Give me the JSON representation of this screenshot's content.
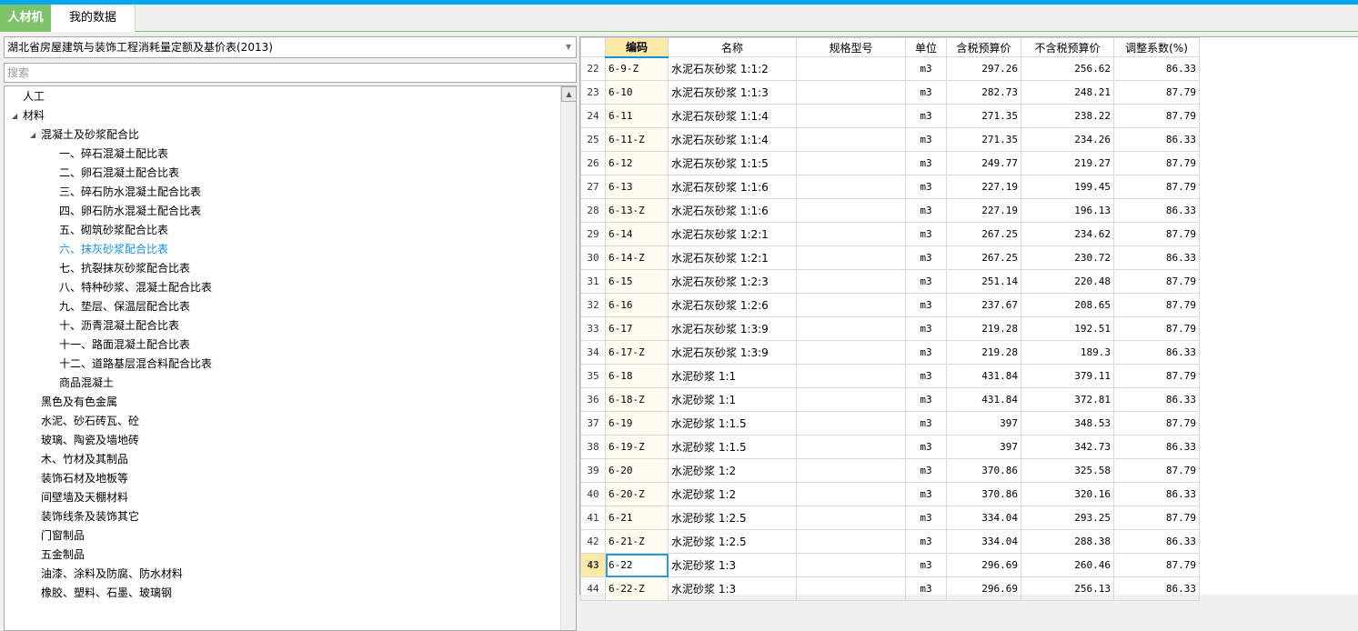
{
  "tabs": [
    {
      "label": "人材机"
    },
    {
      "label": "我的数据"
    }
  ],
  "library_select": {
    "value": "湖北省房屋建筑与装饰工程消耗量定额及基价表(2013)"
  },
  "search": {
    "placeholder": "搜索"
  },
  "tree": [
    {
      "label": "人工",
      "level": 0,
      "expand": false
    },
    {
      "label": "材料",
      "level": 0,
      "expand": true
    },
    {
      "label": "混凝土及砂浆配合比",
      "level": 1,
      "expand": true
    },
    {
      "label": "一、碎石混凝土配比表",
      "level": 2
    },
    {
      "label": "二、卵石混凝土配合比表",
      "level": 2
    },
    {
      "label": "三、碎石防水混凝土配合比表",
      "level": 2
    },
    {
      "label": "四、卵石防水混凝土配合比表",
      "level": 2
    },
    {
      "label": "五、砌筑砂浆配合比表",
      "level": 2
    },
    {
      "label": "六、抹灰砂浆配合比表",
      "level": 2,
      "selected": true
    },
    {
      "label": "七、抗裂抹灰砂浆配合比表",
      "level": 2
    },
    {
      "label": "八、特种砂浆、混凝土配合比表",
      "level": 2
    },
    {
      "label": "九、垫层、保温层配合比表",
      "level": 2
    },
    {
      "label": "十、沥青混凝土配合比表",
      "level": 2
    },
    {
      "label": "十一、路面混凝土配合比表",
      "level": 2
    },
    {
      "label": "十二、道路基层混合料配合比表",
      "level": 2
    },
    {
      "label": "商品混凝土",
      "level": 2
    },
    {
      "label": "黑色及有色金属",
      "level": 1
    },
    {
      "label": "水泥、砂石砖瓦、砼",
      "level": 1
    },
    {
      "label": "玻璃、陶瓷及墙地砖",
      "level": 1
    },
    {
      "label": "木、竹材及其制品",
      "level": 1
    },
    {
      "label": "装饰石材及地板等",
      "level": 1
    },
    {
      "label": "间壁墙及天棚材料",
      "level": 1
    },
    {
      "label": "装饰线条及装饰其它",
      "level": 1
    },
    {
      "label": "门窗制品",
      "level": 1
    },
    {
      "label": "五金制品",
      "level": 1
    },
    {
      "label": "油漆、涂料及防腐、防水材料",
      "level": 1
    },
    {
      "label": "橡胶、塑料、石墨、玻璃钢",
      "level": 1
    }
  ],
  "table": {
    "headers": [
      "",
      "编码",
      "名称",
      "规格型号",
      "单位",
      "含税预算价",
      "不含税预算价",
      "调整系数(%)"
    ],
    "current_row": "43",
    "rows": [
      [
        "22",
        "6-9-Z",
        "水泥石灰砂浆 1:1:2",
        "",
        "m3",
        "297.26",
        "256.62",
        "86.33"
      ],
      [
        "23",
        "6-10",
        "水泥石灰砂浆 1:1:3",
        "",
        "m3",
        "282.73",
        "248.21",
        "87.79"
      ],
      [
        "24",
        "6-11",
        "水泥石灰砂浆 1:1:4",
        "",
        "m3",
        "271.35",
        "238.22",
        "87.79"
      ],
      [
        "25",
        "6-11-Z",
        "水泥石灰砂浆 1:1:4",
        "",
        "m3",
        "271.35",
        "234.26",
        "86.33"
      ],
      [
        "26",
        "6-12",
        "水泥石灰砂浆 1:1:5",
        "",
        "m3",
        "249.77",
        "219.27",
        "87.79"
      ],
      [
        "27",
        "6-13",
        "水泥石灰砂浆 1:1:6",
        "",
        "m3",
        "227.19",
        "199.45",
        "87.79"
      ],
      [
        "28",
        "6-13-Z",
        "水泥石灰砂浆 1:1:6",
        "",
        "m3",
        "227.19",
        "196.13",
        "86.33"
      ],
      [
        "29",
        "6-14",
        "水泥石灰砂浆 1:2:1",
        "",
        "m3",
        "267.25",
        "234.62",
        "87.79"
      ],
      [
        "30",
        "6-14-Z",
        "水泥石灰砂浆 1:2:1",
        "",
        "m3",
        "267.25",
        "230.72",
        "86.33"
      ],
      [
        "31",
        "6-15",
        "水泥石灰砂浆 1:2:3",
        "",
        "m3",
        "251.14",
        "220.48",
        "87.79"
      ],
      [
        "32",
        "6-16",
        "水泥石灰砂浆 1:2:6",
        "",
        "m3",
        "237.67",
        "208.65",
        "87.79"
      ],
      [
        "33",
        "6-17",
        "水泥石灰砂浆 1:3:9",
        "",
        "m3",
        "219.28",
        "192.51",
        "87.79"
      ],
      [
        "34",
        "6-17-Z",
        "水泥石灰砂浆 1:3:9",
        "",
        "m3",
        "219.28",
        "189.3",
        "86.33"
      ],
      [
        "35",
        "6-18",
        "水泥砂浆 1:1",
        "",
        "m3",
        "431.84",
        "379.11",
        "87.79"
      ],
      [
        "36",
        "6-18-Z",
        "水泥砂浆 1:1",
        "",
        "m3",
        "431.84",
        "372.81",
        "86.33"
      ],
      [
        "37",
        "6-19",
        "水泥砂浆 1:1.5",
        "",
        "m3",
        "397",
        "348.53",
        "87.79"
      ],
      [
        "38",
        "6-19-Z",
        "水泥砂浆 1:1.5",
        "",
        "m3",
        "397",
        "342.73",
        "86.33"
      ],
      [
        "39",
        "6-20",
        "水泥砂浆 1:2",
        "",
        "m3",
        "370.86",
        "325.58",
        "87.79"
      ],
      [
        "40",
        "6-20-Z",
        "水泥砂浆 1:2",
        "",
        "m3",
        "370.86",
        "320.16",
        "86.33"
      ],
      [
        "41",
        "6-21",
        "水泥砂浆 1:2.5",
        "",
        "m3",
        "334.04",
        "293.25",
        "87.79"
      ],
      [
        "42",
        "6-21-Z",
        "水泥砂浆 1:2.5",
        "",
        "m3",
        "334.04",
        "288.38",
        "86.33"
      ],
      [
        "43",
        "6-22",
        "水泥砂浆 1:3",
        "",
        "m3",
        "296.69",
        "260.46",
        "87.79"
      ],
      [
        "44",
        "6-22-Z",
        "水泥砂浆 1:3",
        "",
        "m3",
        "296.69",
        "256.13",
        "86.33"
      ]
    ]
  }
}
